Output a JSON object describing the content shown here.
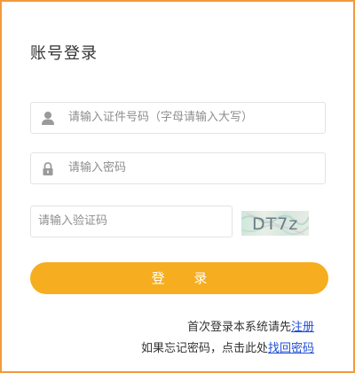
{
  "login": {
    "title": "账号登录",
    "id_placeholder": "请输入证件号码（字母请输入大写）",
    "password_placeholder": "请输入密码",
    "captcha_placeholder": "请输入验证码",
    "captcha_text": "DT7z",
    "login_button": "登 录",
    "register_prefix": "首次登录本系统请先",
    "register_link": "注册",
    "forgot_prefix": "如果忘记密码，点击此处",
    "forgot_link": "找回密码"
  },
  "colors": {
    "border": "#f29a3b",
    "button": "#f6ad1f",
    "link": "#1f4fd8"
  }
}
